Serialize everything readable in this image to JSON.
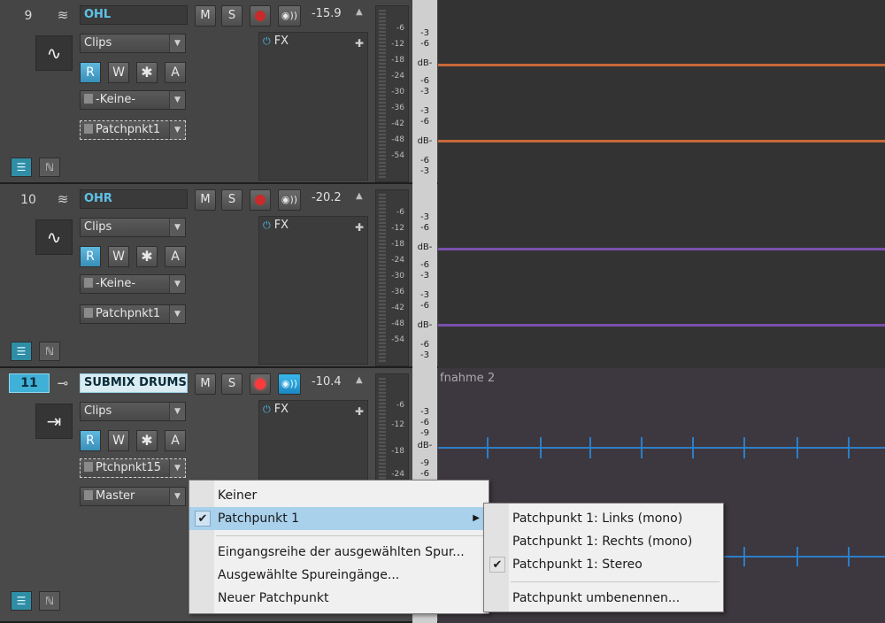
{
  "tracks": [
    {
      "number": "9",
      "name": "OHL",
      "mute": "M",
      "solo": "S",
      "volume": "-15.9",
      "clips": "Clips",
      "input": "-Keine-",
      "output": "Patchpnkt1",
      "automation": [
        "R",
        "W",
        "✱",
        "A"
      ],
      "fx": "FX",
      "meter_labels": [
        "-6",
        "-12",
        "-18",
        "-24",
        "-30",
        "-36",
        "-42",
        "-48",
        "-54"
      ],
      "lane_color": "#c7683a"
    },
    {
      "number": "10",
      "name": "OHR",
      "mute": "M",
      "solo": "S",
      "volume": "-20.2",
      "clips": "Clips",
      "input": "-Keine-",
      "output": "Patchpnkt1",
      "automation": [
        "R",
        "W",
        "✱",
        "A"
      ],
      "fx": "FX",
      "meter_labels": [
        "-6",
        "-12",
        "-18",
        "-24",
        "-30",
        "-36",
        "-42",
        "-48",
        "-54"
      ],
      "lane_color": "#7a4fae"
    },
    {
      "number": "11",
      "name": "SUBMIX DRUMS",
      "mute": "M",
      "solo": "S",
      "volume": "-10.4",
      "clips": "Clips",
      "input": "Ptchpnkt15",
      "output": "Master",
      "automation": [
        "R",
        "W",
        "✱",
        "A"
      ],
      "fx": "FX",
      "meter_labels": [
        "-6",
        "-12",
        "-18",
        "-24"
      ],
      "lane_color": "#2c7fc7",
      "clip_name": "fnahme 2"
    }
  ],
  "scale": {
    "lane1": [
      "-3",
      "-6",
      "dB-",
      "-6",
      "-3",
      "-3",
      "-6",
      "dB-",
      "-6",
      "-3"
    ],
    "lane3": [
      "-3",
      "-6",
      "-9",
      "dB-",
      "-9",
      "-6"
    ]
  },
  "context_menu": {
    "items": [
      {
        "label": "Keiner",
        "checked": false
      },
      {
        "label": "Patchpunkt 1",
        "checked": true,
        "has_submenu": true
      },
      {
        "label": "Eingangsreihe der ausgewählten Spur...",
        "checked": false
      },
      {
        "label": "Ausgewählte Spureingänge...",
        "checked": false
      },
      {
        "label": "Neuer Patchpunkt",
        "checked": false
      }
    ]
  },
  "submenu": {
    "items": [
      {
        "label": "Patchpunkt 1: Links (mono)",
        "checked": false
      },
      {
        "label": "Patchpunkt 1: Rechts (mono)",
        "checked": false
      },
      {
        "label": "Patchpunkt 1: Stereo",
        "checked": true
      },
      {
        "label": "Patchpunkt umbenennen...",
        "checked": false
      }
    ]
  },
  "icons": {
    "track_type": "eq-icon",
    "clip_icon": "waveform-icon",
    "bus_icon": "arrow-in-icon",
    "power": "power-icon",
    "add": "plus-icon",
    "mute_input": "input-icon"
  }
}
